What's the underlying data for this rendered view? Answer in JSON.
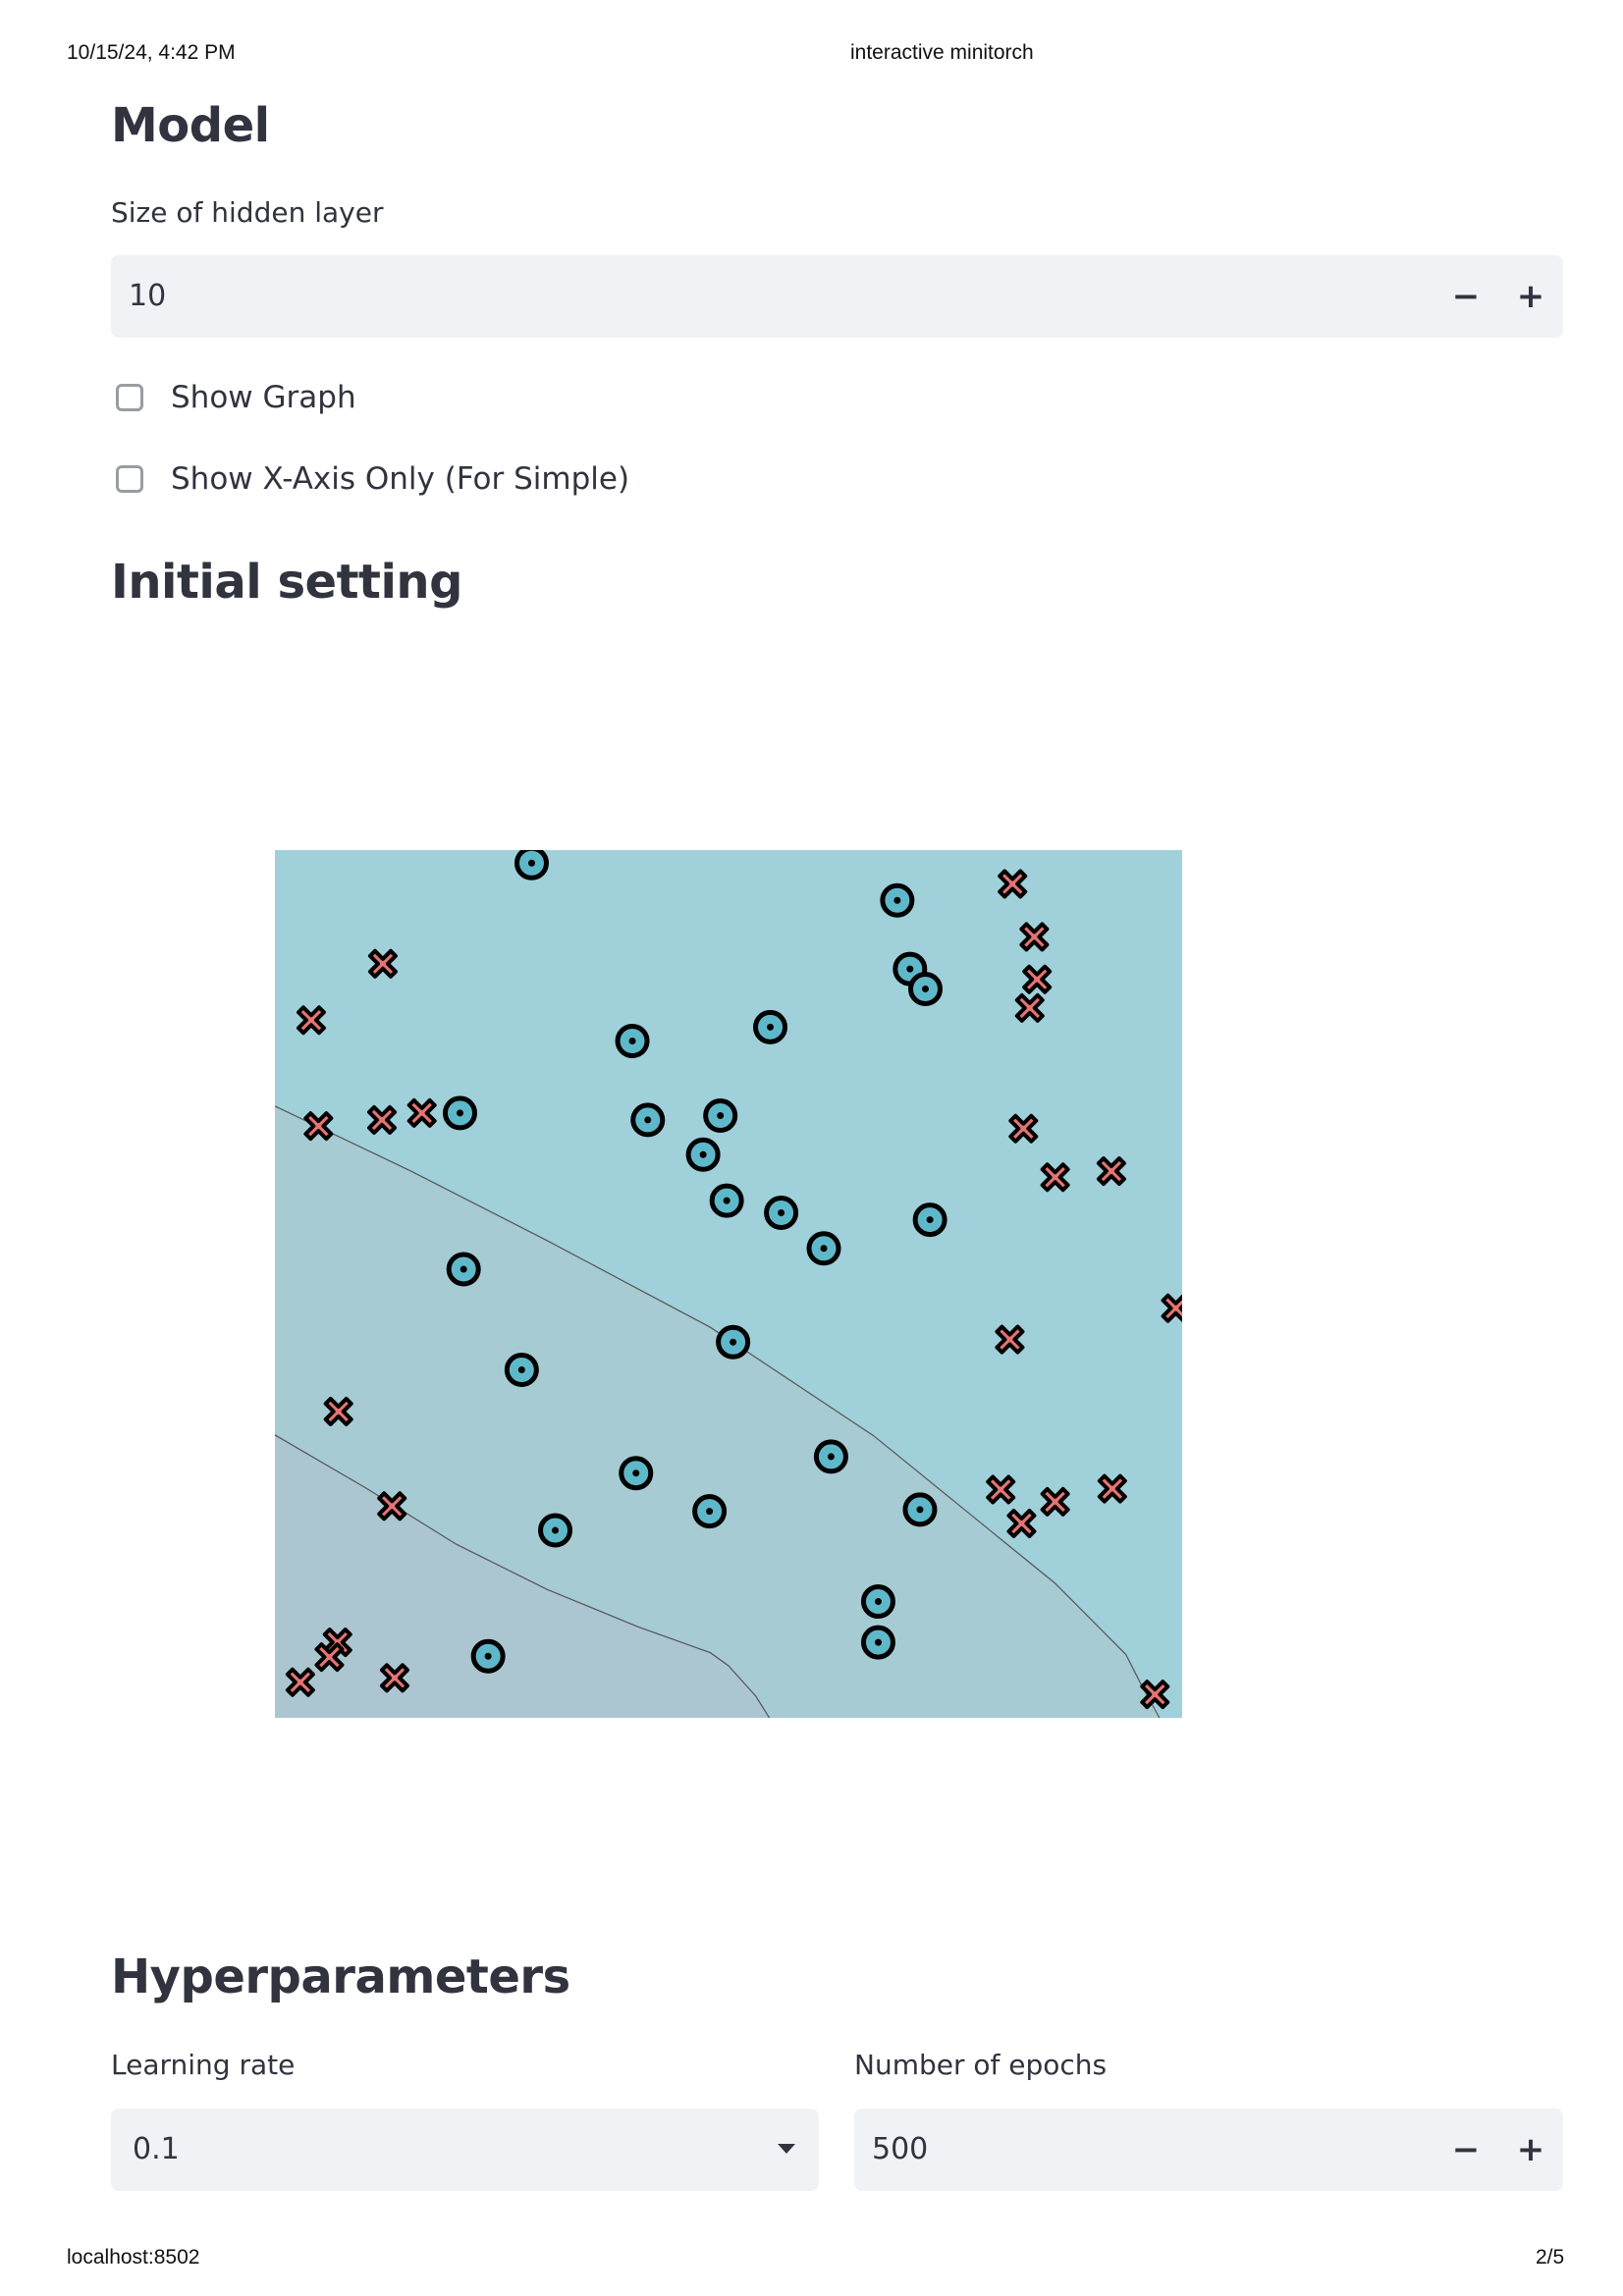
{
  "print": {
    "datetime": "10/15/24, 4:42 PM",
    "title": "interactive minitorch",
    "url": "localhost:8502",
    "page": "2/5"
  },
  "model": {
    "heading": "Model",
    "hidden_layer_label": "Size of hidden layer",
    "hidden_layer_value": "10",
    "minus": "−",
    "plus": "+",
    "show_graph_label": "Show Graph",
    "show_graph_checked": false,
    "show_xaxis_label": "Show X-Axis Only (For Simple)",
    "show_xaxis_checked": false
  },
  "initial": {
    "heading": "Initial setting"
  },
  "hyper": {
    "heading": "Hyperparameters",
    "lr_label": "Learning rate",
    "lr_value": "0.1",
    "epochs_label": "Number of epochs",
    "epochs_value": "500",
    "minus": "−",
    "plus": "+"
  },
  "chart_data": {
    "type": "scatter",
    "xlim": [
      0,
      1
    ],
    "ylim": [
      0,
      1
    ],
    "grid": false,
    "colors": {
      "region_top": "#a0d0da",
      "region_mid": "#a6cbd3",
      "region_bottom": "#abc6d0",
      "circle_fill": "#5fb8c9",
      "cross_fill": "#e57373",
      "outline": "#000000",
      "contour": "#555555"
    },
    "series": [
      {
        "marker": "circle",
        "points": [
          [
            0.283,
            0.985
          ],
          [
            0.686,
            0.942
          ],
          [
            0.7,
            0.863
          ],
          [
            0.717,
            0.84
          ],
          [
            0.394,
            0.78
          ],
          [
            0.546,
            0.796
          ],
          [
            0.204,
            0.697
          ],
          [
            0.411,
            0.689
          ],
          [
            0.491,
            0.694
          ],
          [
            0.472,
            0.649
          ],
          [
            0.498,
            0.596
          ],
          [
            0.558,
            0.582
          ],
          [
            0.722,
            0.574
          ],
          [
            0.605,
            0.541
          ],
          [
            0.208,
            0.517
          ],
          [
            0.505,
            0.433
          ],
          [
            0.272,
            0.401
          ],
          [
            0.613,
            0.301
          ],
          [
            0.398,
            0.282
          ],
          [
            0.479,
            0.238
          ],
          [
            0.711,
            0.24
          ],
          [
            0.309,
            0.216
          ],
          [
            0.665,
            0.134
          ],
          [
            0.665,
            0.087
          ],
          [
            0.235,
            0.071
          ]
        ]
      },
      {
        "marker": "cross",
        "points": [
          [
            0.813,
            0.961
          ],
          [
            0.837,
            0.9
          ],
          [
            0.84,
            0.851
          ],
          [
            0.832,
            0.818
          ],
          [
            0.119,
            0.869
          ],
          [
            0.04,
            0.804
          ],
          [
            0.048,
            0.682
          ],
          [
            0.118,
            0.689
          ],
          [
            0.162,
            0.697
          ],
          [
            0.825,
            0.679
          ],
          [
            0.86,
            0.623
          ],
          [
            0.922,
            0.63
          ],
          [
            0.993,
            0.472
          ],
          [
            0.81,
            0.436
          ],
          [
            0.07,
            0.353
          ],
          [
            0.129,
            0.244
          ],
          [
            0.8,
            0.263
          ],
          [
            0.86,
            0.249
          ],
          [
            0.923,
            0.264
          ],
          [
            0.823,
            0.224
          ],
          [
            0.069,
            0.087
          ],
          [
            0.06,
            0.07
          ],
          [
            0.028,
            0.041
          ],
          [
            0.132,
            0.046
          ],
          [
            0.97,
            0.027
          ]
        ]
      }
    ],
    "contours": [
      [
        [
          0,
          0.705
        ],
        [
          0.15,
          0.63
        ],
        [
          0.3,
          0.55
        ],
        [
          0.48,
          0.45
        ],
        [
          0.66,
          0.325
        ],
        [
          0.76,
          0.24
        ],
        [
          0.86,
          0.155
        ],
        [
          0.938,
          0.073
        ],
        [
          0.955,
          0.038
        ],
        [
          0.975,
          0
        ]
      ],
      [
        [
          0,
          0.326
        ],
        [
          0.1,
          0.265
        ],
        [
          0.2,
          0.2
        ],
        [
          0.3,
          0.148
        ],
        [
          0.4,
          0.105
        ],
        [
          0.48,
          0.075
        ],
        [
          0.5,
          0.06
        ],
        [
          0.53,
          0.025
        ],
        [
          0.545,
          0
        ]
      ]
    ]
  }
}
